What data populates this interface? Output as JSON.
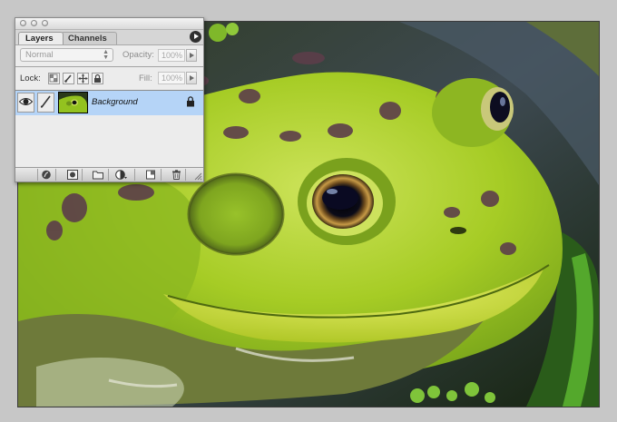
{
  "palette": {
    "tabs": [
      {
        "label": "Layers",
        "active": true
      },
      {
        "label": "Channels",
        "active": false
      }
    ],
    "blend_mode": {
      "value": "Normal"
    },
    "opacity": {
      "label": "Opacity:",
      "value": "100%"
    },
    "lock": {
      "label": "Lock:"
    },
    "fill": {
      "label": "Fill:",
      "value": "100%"
    },
    "layers": [
      {
        "name": "Background",
        "visible": true,
        "locked": true,
        "selected": true
      }
    ],
    "bottom_icons": [
      "layer-style-icon",
      "layer-mask-icon",
      "new-folder-icon",
      "adjustment-layer-icon",
      "new-layer-icon",
      "trash-icon"
    ]
  },
  "document": {
    "content": "frog-photo",
    "colors": {
      "frog_green": "#9ccc1e",
      "spots": "#5c3e4a",
      "background": "#1e2b1a"
    }
  }
}
